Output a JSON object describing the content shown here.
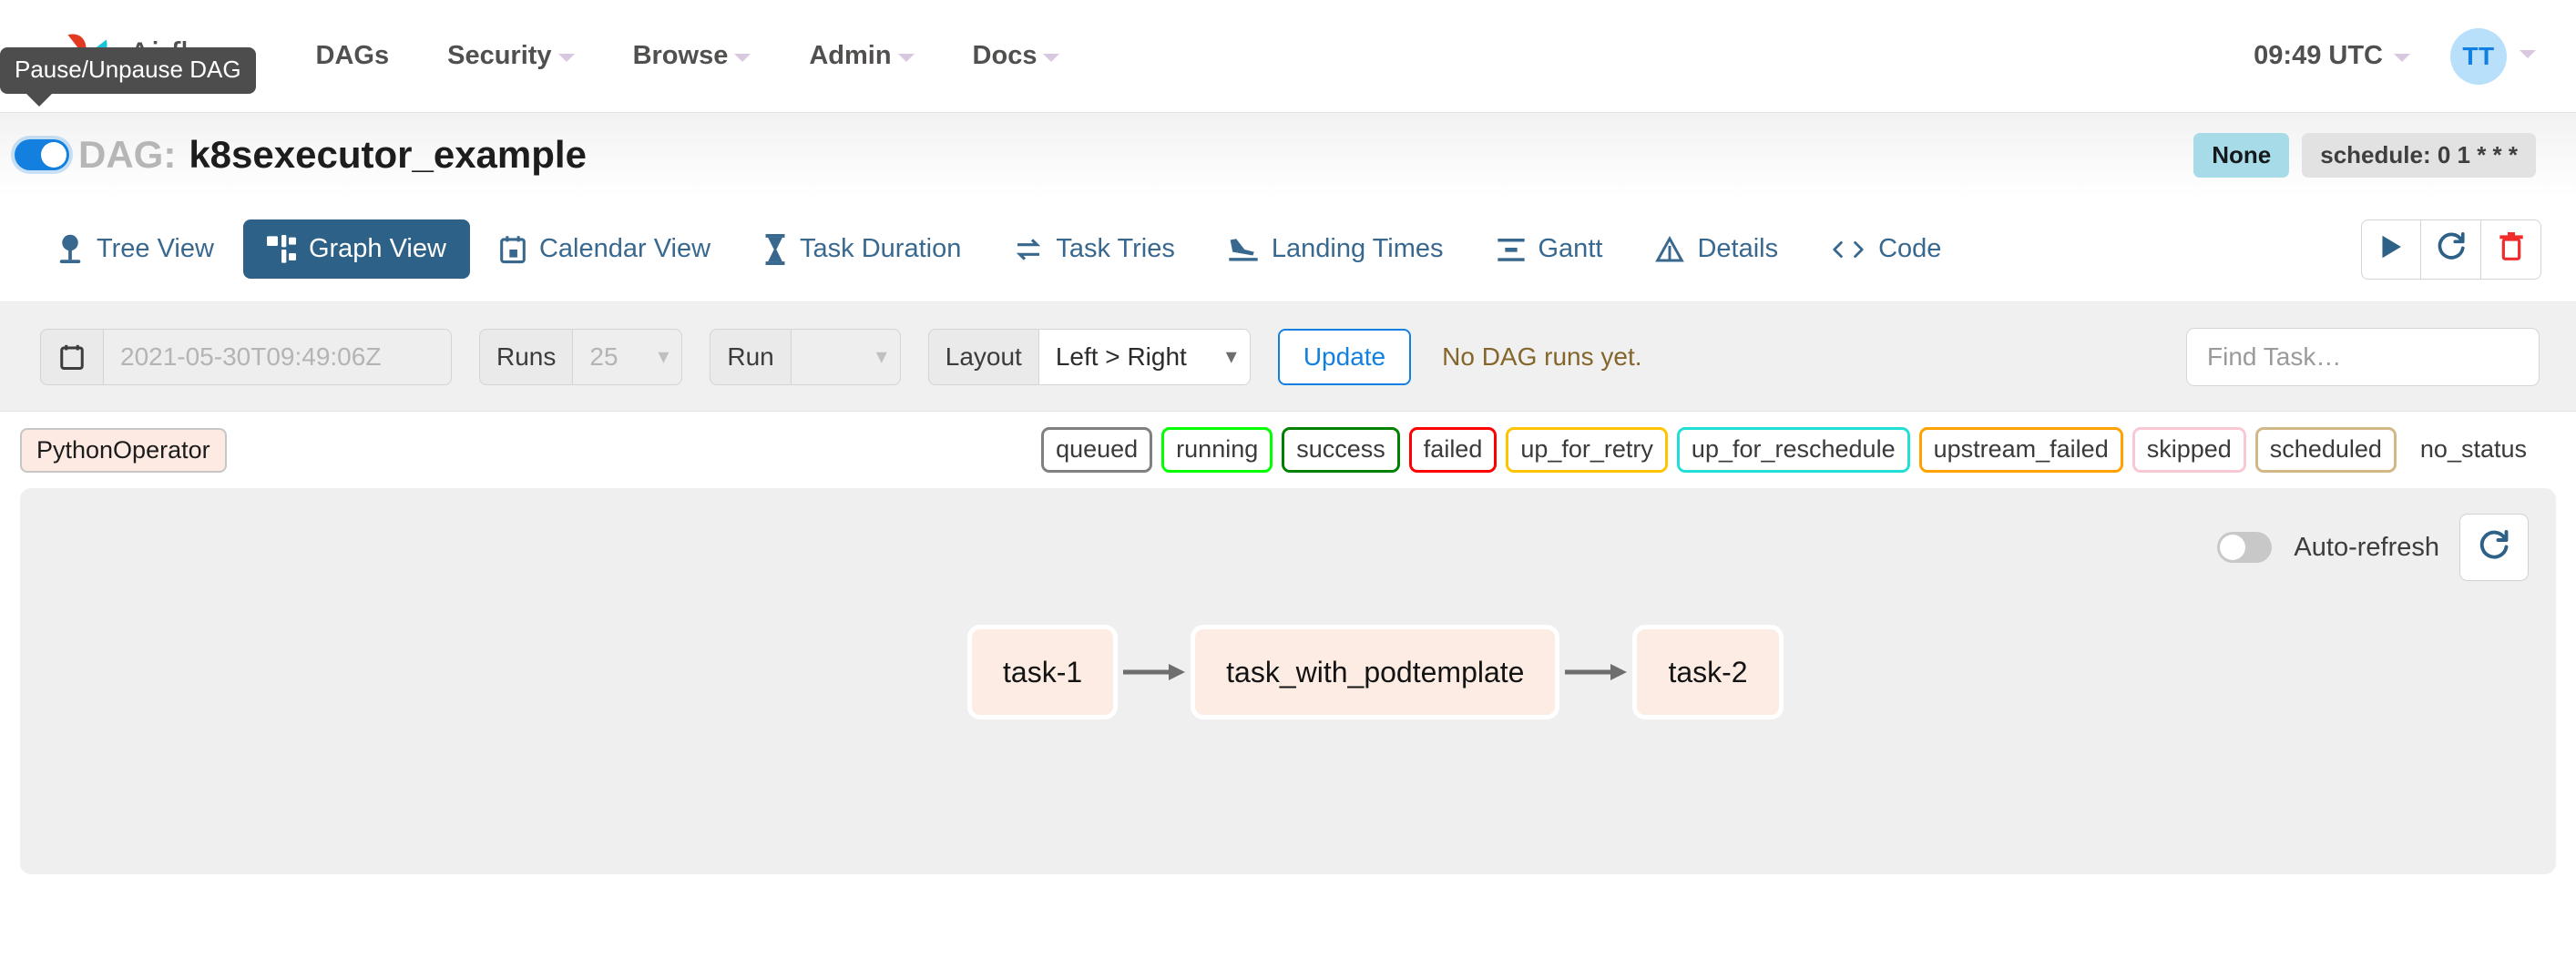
{
  "navbar": {
    "brand": "Airflow",
    "items": [
      {
        "label": "DAGs",
        "has_caret": false
      },
      {
        "label": "Security",
        "has_caret": true
      },
      {
        "label": "Browse",
        "has_caret": true
      },
      {
        "label": "Admin",
        "has_caret": true
      },
      {
        "label": "Docs",
        "has_caret": true
      }
    ],
    "clock": "09:49 UTC",
    "avatar_initials": "TT"
  },
  "header": {
    "tooltip": "Pause/Unpause DAG",
    "dag_label": "DAG:",
    "dag_name": "k8sexecutor_example",
    "paused_toggle_on": true,
    "badge_none": "None",
    "badge_schedule": "schedule: 0 1 * * *"
  },
  "tabs": [
    {
      "label": "Tree View",
      "icon": "tree-icon",
      "active": false
    },
    {
      "label": "Graph View",
      "icon": "graph-icon",
      "active": true
    },
    {
      "label": "Calendar View",
      "icon": "calendar-icon",
      "active": false
    },
    {
      "label": "Task Duration",
      "icon": "hourglass-icon",
      "active": false
    },
    {
      "label": "Task Tries",
      "icon": "retry-icon",
      "active": false
    },
    {
      "label": "Landing Times",
      "icon": "plane-landing-icon",
      "active": false
    },
    {
      "label": "Gantt",
      "icon": "gantt-icon",
      "active": false
    },
    {
      "label": "Details",
      "icon": "info-triangle-icon",
      "active": false
    },
    {
      "label": "Code",
      "icon": "code-icon",
      "active": false
    }
  ],
  "tab_actions": [
    {
      "name": "trigger-dag-button",
      "icon": "play-icon"
    },
    {
      "name": "refresh-dag-button",
      "icon": "refresh-icon"
    },
    {
      "name": "delete-dag-button",
      "icon": "trash-icon"
    }
  ],
  "filterbar": {
    "date_placeholder": "2021-05-30T09:49:06Z",
    "date_value": "",
    "runs_label": "Runs",
    "runs_value": "25",
    "run_label": "Run",
    "run_value": "",
    "layout_label": "Layout",
    "layout_value": "Left > Right",
    "update_label": "Update",
    "status_message": "No DAG runs yet.",
    "find_task_placeholder": "Find Task…",
    "find_task_value": ""
  },
  "legend": {
    "operator_badge": "PythonOperator",
    "statuses": [
      {
        "label": "queued",
        "color": "#808080"
      },
      {
        "label": "running",
        "color": "#01ff00"
      },
      {
        "label": "success",
        "color": "#008000"
      },
      {
        "label": "failed",
        "color": "#ff0000"
      },
      {
        "label": "up_for_retry",
        "color": "#ffc400"
      },
      {
        "label": "up_for_reschedule",
        "color": "#22ded7"
      },
      {
        "label": "upstream_failed",
        "color": "#ffa200"
      },
      {
        "label": "skipped",
        "color": "#f8c8d4"
      },
      {
        "label": "scheduled",
        "color": "#d3b887"
      },
      {
        "label": "no_status",
        "color": "transparent"
      }
    ]
  },
  "graph": {
    "auto_refresh_label": "Auto-refresh",
    "auto_refresh_on": false,
    "nodes": [
      {
        "label": "task-1"
      },
      {
        "label": "task_with_podtemplate"
      },
      {
        "label": "task-2"
      }
    ]
  }
}
